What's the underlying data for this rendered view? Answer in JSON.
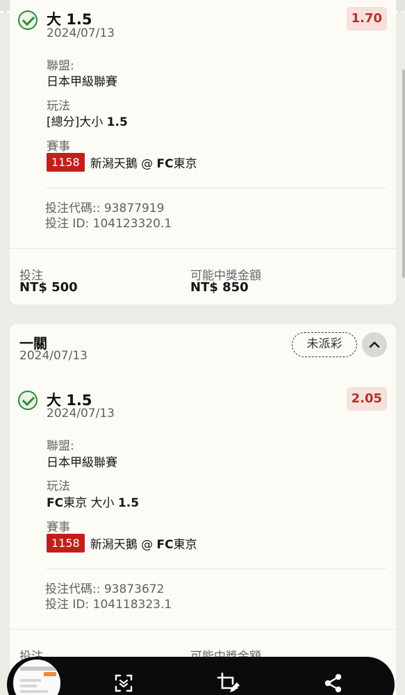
{
  "card1": {
    "selection": {
      "title": "大 1.5",
      "date": "2024/07/13",
      "odds": "1.70",
      "league_label": "聯盟:",
      "league_value": "日本甲級聯賽",
      "play_label": "玩法",
      "play_prefix": "[總分]大小 ",
      "play_line": "1.5",
      "event_label": "賽事",
      "match_no": "1158",
      "home": "新潟天鵝 @ ",
      "away_bold": "FC",
      "away_rest": "東京"
    },
    "bet_code": "投注代碼:: 93877919",
    "bet_id": "投注 ID: 104123320.1",
    "stake_label": "投注",
    "stake_value": "NT$ 500",
    "payout_label": "可能中獎金額",
    "payout_value": "NT$ 850"
  },
  "card2": {
    "title": "一關",
    "date": "2024/07/13",
    "status": "未派彩",
    "selection": {
      "title": "大 1.5",
      "date": "2024/07/13",
      "odds": "2.05",
      "league_label": "聯盟:",
      "league_value": "日本甲級聯賽",
      "play_label": "玩法",
      "play_bold": "FC",
      "play_rest": "東京 大小 ",
      "play_line": "1.5",
      "event_label": "賽事",
      "match_no": "1158",
      "home": "新潟天鵝 @ ",
      "away_bold": "FC",
      "away_rest": "東京"
    },
    "bet_code": "投注代碼:: 93873672",
    "bet_id": "投注 ID: 104118323.1",
    "stake_label": "投注",
    "payout_label": "可能中獎金額"
  },
  "toolbar": {
    "icons": [
      "screenshot-thumbnail",
      "scroll-capture-icon",
      "crop-edit-icon",
      "share-icon"
    ]
  },
  "colors": {
    "accent_red": "#c1201a",
    "odds_text": "#b5312a",
    "success_green": "#2f8a3b"
  }
}
